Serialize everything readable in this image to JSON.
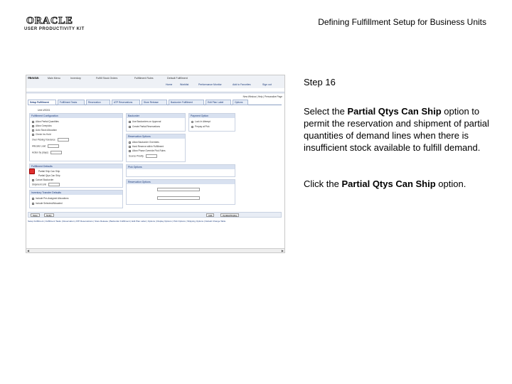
{
  "header": {
    "logo_text": "ORACLE",
    "logo_subtext": "USER PRODUCTIVITY KIT",
    "title": "Defining Fulfillment Setup for Business Units"
  },
  "instructions": {
    "step_label": "Step 16",
    "desc_pre": "Select the ",
    "desc_bold": "Partial Qtys Can Ship",
    "desc_post": " option to permit the reservation and shipment of partial quantities of demand lines when there is insufficient stock available to fulfill demand.",
    "action_pre": "Click the ",
    "action_bold": "Partial Qtys Can Ship",
    "action_post": " option."
  },
  "screenshot": {
    "brand": "ORACLE",
    "nav_items": [
      "Favorites",
      "Main Menu",
      "Inventory",
      "Fulfill Stock Orders",
      "Fulfillment Rules",
      "Default Fulfillment"
    ],
    "header_links": [
      "Home",
      "Worklist",
      "Performance Monitor",
      "Add to Favorites",
      "Sign out"
    ],
    "toolbar": "New Window | Help | Personalize Page",
    "tabs": [
      "Setup Fulfillment",
      "Fulfillment Tasks",
      "Reservation",
      "ATP Reservations",
      "Store Release",
      "Backorder Fulfillment",
      "Edit Plan Label",
      "Options"
    ],
    "unit": "Unit US001",
    "panels": {
      "fulfillment_config": "Fulfillment Configuration",
      "backorder": "Backorder",
      "payment_option": "Payment Option",
      "reservation": "Reservation Options",
      "pick_options": "Pick Options",
      "fulfillment_defaults": "Fulfillment Defaults",
      "reserve_options": "Reservation Options",
      "transfer_defaults": "Inventory Transfer Defaults"
    },
    "config_rows": [
      "Allow Partial Quantities",
      "Allow Overpicks",
      "Auto Stock Allocation",
      "Check Inv Hold",
      "Over Picking Tolerance",
      "Allocate Load",
      "Action by (days)"
    ],
    "backorder_rows": [
      "Use Backorders on Approval",
      "Create Partial Reservations"
    ],
    "payment_rows": [
      "Lock In Attempt",
      "Prepay at Pick"
    ],
    "reservation_rows": [
      "Allow Backorder Overrides",
      "Hard Reserve within Fulfillment",
      "Allow Phase Override Pick Rules",
      "Source Priority"
    ],
    "defaults_rows": [
      "Partial Ship Can Ship",
      "Partial Qtys Can Ship",
      "Cancel Backorder",
      "Shipment Unit"
    ],
    "transfer_rows": [
      "Include Pre-Assigned Allocations",
      "Include Selected/Allocated"
    ],
    "bottom_buttons": [
      "Save",
      "Notify",
      "Add",
      "Update/Display"
    ],
    "footer": "Setup Fulfillment | Fulfillment Tasks | Reservation | ATP Reservations | Store Release | Backorder Fulfillment | Edit Plan Label | Options | Display Options | Pick Options | Shipping Options | Default Change Table"
  }
}
